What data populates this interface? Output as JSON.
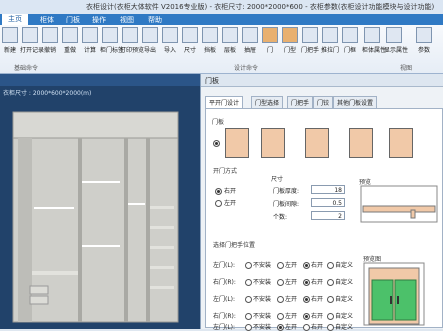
{
  "title": {
    "text": "衣柜设计(衣柜大体软件 V2016专业版) - 衣柜尺寸: 2000*2000*600 - 衣柜参数(衣柜设计功能模块与设计功能)"
  },
  "menu": [
    "主页",
    "柜体",
    "门板",
    "操作",
    "视图",
    "帮助"
  ],
  "menu_active": 0,
  "ribbon": {
    "tools": [
      "新建",
      "打开记录",
      "撤销",
      "重做",
      "计算",
      "柜门标签",
      "打印预览",
      "导出",
      "导入",
      "尺寸",
      "挡板",
      "层板",
      "抽屉",
      "门",
      "门型",
      "门把手",
      "推拉门",
      "门框",
      "柜体属性",
      "显示属性",
      "参数"
    ],
    "groups": [
      "基础命令",
      "设计命令",
      "视图"
    ]
  },
  "viewport": {
    "caption": "",
    "info": "衣柜尺寸 : 2000*600*2000(m)"
  },
  "dialog": {
    "title": "门板",
    "tabs": [
      "平开门设计",
      "门型选择",
      "门把手",
      "门铰",
      "其他门板设置"
    ],
    "active_tab": 0,
    "section_doors": "门板",
    "door_style_label": "门板",
    "open_mode": {
      "label": "开门方式",
      "options": [
        "右开",
        "左开"
      ],
      "selected": 0
    },
    "dims": {
      "label": "尺寸",
      "fields": [
        {
          "label": "门板厚度:",
          "value": "18"
        },
        {
          "label": "门板间隙:",
          "value": "0.5"
        },
        {
          "label": "个数:",
          "value": "2"
        }
      ]
    },
    "preview_label": "预览",
    "handles": {
      "label": "选择门把手位置",
      "rows": [
        {
          "label": "左门(L):",
          "options": [
            "不安装",
            "左开",
            "右开",
            "自定义"
          ],
          "selected": 2
        },
        {
          "label": "右门(R):",
          "options": [
            "不安装",
            "左开",
            "右开",
            "自定义"
          ],
          "selected": 2
        },
        {
          "label": "左门(L):",
          "options": [
            "不安装",
            "左开",
            "右开",
            "自定义"
          ],
          "selected": 2
        },
        {
          "label": "右门(R):",
          "options": [
            "不安装",
            "左开",
            "右开",
            "自定义"
          ],
          "selected": 2
        },
        {
          "label": "左门(L):",
          "options": [
            "不安装",
            "左开",
            "右开",
            "自定义"
          ],
          "selected": 1
        }
      ],
      "preview_label": "预览图"
    }
  },
  "colors": {
    "menubar": "#2f79c4",
    "viewport_bg": "#21426a",
    "door_fill": "#f1c9a8",
    "wardrobe_wood": "#c9c9c4",
    "preview_green": "#4cc16a"
  }
}
